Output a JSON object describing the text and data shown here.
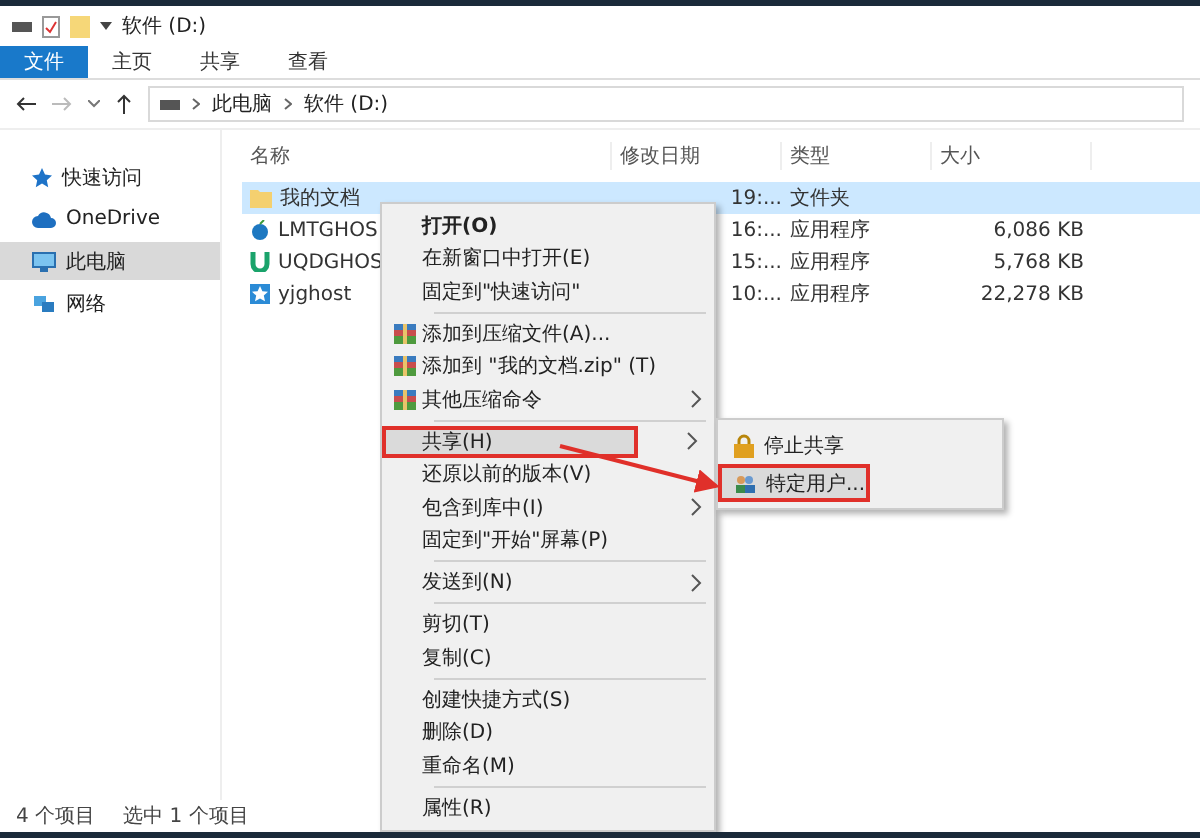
{
  "title_bar": {
    "title": "软件 (D:)"
  },
  "ribbon_tabs": [
    {
      "label": "文件",
      "selected": true
    },
    {
      "label": "主页",
      "selected": false
    },
    {
      "label": "共享",
      "selected": false
    },
    {
      "label": "查看",
      "selected": false
    }
  ],
  "address_bar": {
    "crumbs": [
      "此电脑",
      "软件 (D:)"
    ]
  },
  "nav_pane": [
    {
      "label": "快速访问",
      "kind": "star",
      "selected": false
    },
    {
      "label": "OneDrive",
      "kind": "cloud",
      "selected": false
    },
    {
      "label": "此电脑",
      "kind": "pc",
      "selected": true
    },
    {
      "label": "网络",
      "kind": "network",
      "selected": false
    }
  ],
  "columns": [
    "名称",
    "修改日期",
    "类型",
    "大小"
  ],
  "files": [
    {
      "name": "我的文档",
      "kind": "folder",
      "date": "19:...",
      "type": "文件夹",
      "selected": true
    },
    {
      "name": "LMTGHOS",
      "kind": "apple",
      "date": "16:...",
      "type": "应用程序",
      "size": "6,086 KB",
      "selected": false
    },
    {
      "name": "UQDGHOS",
      "kind": "u",
      "date": "15:...",
      "type": "应用程序",
      "size": "5,768 KB",
      "selected": false
    },
    {
      "name": "yjghost",
      "kind": "star",
      "date": "10:...",
      "type": "应用程序",
      "size": "22,278 KB",
      "selected": false
    }
  ],
  "status_bar": {
    "count": "4 个项目",
    "selection": "选中 1 个项目"
  },
  "context_menu": [
    {
      "kind": "item",
      "label": "打开(O)",
      "bold": true,
      "submenu": false,
      "highlighted": false
    },
    {
      "kind": "item",
      "label": "在新窗口中打开(E)",
      "bold": false,
      "submenu": false,
      "highlighted": false
    },
    {
      "kind": "item",
      "label": "固定到\"快速访问\"",
      "bold": false,
      "submenu": false,
      "highlighted": false
    },
    {
      "kind": "separator"
    },
    {
      "kind": "archive",
      "label": "添加到压缩文件(A)...",
      "bold": false,
      "submenu": false,
      "highlighted": false
    },
    {
      "kind": "archive",
      "label": "添加到 \"我的文档.zip\" (T)",
      "bold": false,
      "submenu": false,
      "highlighted": false
    },
    {
      "kind": "archive",
      "label": "其他压缩命令",
      "bold": false,
      "submenu": true,
      "highlighted": false
    },
    {
      "kind": "separator"
    },
    {
      "kind": "item",
      "label": "共享(H)",
      "bold": false,
      "submenu": true,
      "highlighted": true
    },
    {
      "kind": "item",
      "label": "还原以前的版本(V)",
      "bold": false,
      "submenu": false,
      "highlighted": false
    },
    {
      "kind": "item",
      "label": "包含到库中(I)",
      "bold": false,
      "submenu": true,
      "highlighted": false
    },
    {
      "kind": "item",
      "label": "固定到\"开始\"屏幕(P)",
      "bold": false,
      "submenu": false,
      "highlighted": false
    },
    {
      "kind": "separator"
    },
    {
      "kind": "item",
      "label": "发送到(N)",
      "bold": false,
      "submenu": true,
      "highlighted": false
    },
    {
      "kind": "separator"
    },
    {
      "kind": "item",
      "label": "剪切(T)",
      "bold": false,
      "submenu": false,
      "highlighted": false
    },
    {
      "kind": "item",
      "label": "复制(C)",
      "bold": false,
      "submenu": false,
      "highlighted": false
    },
    {
      "kind": "separator"
    },
    {
      "kind": "item",
      "label": "创建快捷方式(S)",
      "bold": false,
      "submenu": false,
      "highlighted": false
    },
    {
      "kind": "item",
      "label": "删除(D)",
      "bold": false,
      "submenu": false,
      "highlighted": false
    },
    {
      "kind": "item",
      "label": "重命名(M)",
      "bold": false,
      "submenu": false,
      "highlighted": false
    },
    {
      "kind": "separator"
    },
    {
      "kind": "item",
      "label": "属性(R)",
      "bold": false,
      "submenu": false,
      "highlighted": false
    }
  ],
  "share_submenu": [
    {
      "label": "停止共享",
      "highlighted": false
    },
    {
      "label": "特定用户...",
      "highlighted": true
    }
  ]
}
